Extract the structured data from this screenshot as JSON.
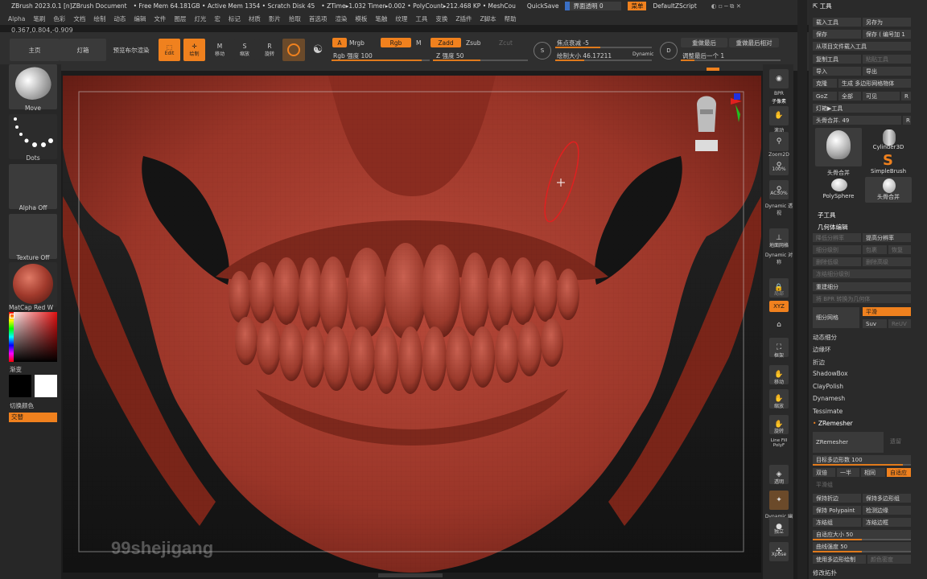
{
  "titlebar": {
    "items": [
      "ZBrush 2023.0.1 [n]ZBrush Document",
      "• Free Mem 64.181GB • Active Mem 1354 • Scratch Disk 45",
      "• ZTime▸1.032 Timer▸0.002 • PolyCount▸212.468 KP • MeshCou"
    ],
    "quicksave": "QuickSave",
    "transparency": "界面透明 0",
    "menu_btn": "菜单",
    "script": "DefaultZScript"
  },
  "menubar": [
    "Alpha",
    "笔刷",
    "色彩",
    "文档",
    "绘制",
    "动态",
    "编辑",
    "文件",
    "图层",
    "灯光",
    "宏",
    "标记",
    "材质",
    "影片",
    "拾取",
    "首选项",
    "渲染",
    "模板",
    "笔触",
    "纹理",
    "工具",
    "变换",
    "Z插件",
    "Z脚本",
    "帮助"
  ],
  "coords": "0.367,0.804,-0.909",
  "topshelf": {
    "home": "主页",
    "lightbox": "灯箱",
    "bpr": "预览布尔渲染",
    "edit": "Edit",
    "draw": "绘制",
    "move": "移动",
    "scale": "缩放",
    "rotate": "旋转",
    "a_btn": "A",
    "mrgb": "Mrgb",
    "rgb": "Rgb",
    "m": "M",
    "rgb_intensity": "Rgb 强度 100",
    "zadd": "Zadd",
    "zsub": "Zsub",
    "zcut": "Zcut",
    "z_intensity": "Z 强度 50",
    "focal_shift": "焦点衰减 -5",
    "draw_size": "绘制大小 46.17211",
    "dynamic": "Dynamic",
    "replay_last": "重做最后",
    "replay_last_rel": "重做最后相对",
    "adjust_last": "调整最后一个 1",
    "s_label": "S",
    "d_label": "D"
  },
  "leftshelf": {
    "brush": "Move",
    "stroke": "Dots",
    "alpha": "Alpha Off",
    "texture": "Texture Off",
    "material": "MatCap Red W",
    "gradient": "渐变",
    "switch_color": "切换颜色",
    "alternate": "交替"
  },
  "rightshelf": [
    {
      "label": "BPR",
      "icon": "bpr-icon"
    },
    {
      "label": "子像素",
      "icon": "subpixel-icon"
    },
    {
      "label": "滚动",
      "icon": "scroll-icon"
    },
    {
      "label": "Zoom2D",
      "icon": "zoom2d-icon"
    },
    {
      "label": "100%",
      "icon": "actual-icon"
    },
    {
      "label": "AC50%",
      "icon": "ac50-icon"
    },
    {
      "label": "Dynamic 透视",
      "icon": "persp-icon"
    },
    {
      "label": "地面网格",
      "icon": "floor-icon"
    },
    {
      "label": "Dynamic 对称",
      "icon": "sym-icon"
    },
    {
      "label": "局部",
      "icon": "local-icon"
    },
    {
      "label": "XYZ",
      "icon": "xyz-icon"
    },
    {
      "label": "框架",
      "icon": "frame-icon"
    },
    {
      "label": "移动",
      "icon": "move-icon"
    },
    {
      "label": "缩放",
      "icon": "scale-icon"
    },
    {
      "label": "旋转",
      "icon": "rotate-icon"
    },
    {
      "label": "Line Fill PolyF",
      "icon": "polyf-icon"
    },
    {
      "label": "透明",
      "icon": "transp-icon"
    },
    {
      "label": "Dynamic 幽灵",
      "icon": "ghost-icon"
    },
    {
      "label": "独立",
      "icon": "solo-icon"
    },
    {
      "label": "Xpose",
      "icon": "xpose-icon"
    }
  ],
  "rightpanel": {
    "title": "工具",
    "load_tool": "载入工具",
    "save_as": "另存为",
    "save": "保存",
    "save_inc": "保存 ( 编号加 1",
    "load_from_project": "从项目文件载入工具",
    "copy_tool": "复制工具",
    "paste_tool": "粘贴工具",
    "import": "导入",
    "export": "导出",
    "clone": "克隆",
    "make_polymesh": "生成 多边形网格物体",
    "goz": "GoZ",
    "all": "全部",
    "visible": "可见",
    "r": "R",
    "lightbox_tool": "灯箱▶工具",
    "current_tool": "头骨合并. 49",
    "tools": [
      {
        "name": "头骨合并",
        "icon": "skull-icon"
      },
      {
        "name": "Cylinder3D",
        "icon": "cylinder-icon"
      },
      {
        "name": "SimpleBrush",
        "icon": "simplebrush-icon"
      },
      {
        "name": "PolySphere",
        "icon": "polysphere-icon"
      },
      {
        "name": "头骨合并",
        "icon": "skull-small-icon"
      }
    ],
    "subtool": "子工具",
    "geometry": "几何体编辑",
    "lower_res": "降低分辨率",
    "higher_res": "提高分辨率",
    "subdiv_level": "细分级别",
    "cage": "包裹",
    "rstr": "恢复",
    "del_lower": "删除低级",
    "del_higher": "删除高级",
    "freeze_subdiv": "冻结细分级别",
    "reconstruct": "重建细分",
    "convert_bpr": "将 BPR 转换为几何体",
    "divide": "细分网格",
    "smooth": "平滑",
    "suv": "Suv",
    "reuv": "ReUV",
    "dynamic_subdiv": "动态细分",
    "edge_loop": "边缘环",
    "crease": "折边",
    "shadowbox": "ShadowBox",
    "claypolish": "ClayPolish",
    "dynamesh": "Dynamesh",
    "tessimate": "Tessimate",
    "zremesher": "ZRemesher",
    "zremesher_btn": "ZRemesher",
    "legacy": "遗留",
    "target_poly": "目标多边形数 100",
    "half": "双倍",
    "same": "一半",
    "same2": "相同",
    "adaptive": "自适应",
    "smooth_groups": "平滑组",
    "keep_creases": "保持折边",
    "keep_groups": "保持多边形组",
    "keep_polypaint": "保持 Polypaint",
    "detect_edges": "检测边缘",
    "freeze_border": "冻结组",
    "freeze_border2": "冻结边框",
    "adaptive_size": "自适应大小 50",
    "curves_strength": "曲线强度 50",
    "use_polypaint": "使用多边形绘制",
    "color_density": "颜色密度",
    "modify_topo": "修改拓扑"
  },
  "viewport": {
    "watermark": "99shejigang"
  },
  "colors": {
    "accent": "#f0811e",
    "model": "#a13a2c"
  }
}
